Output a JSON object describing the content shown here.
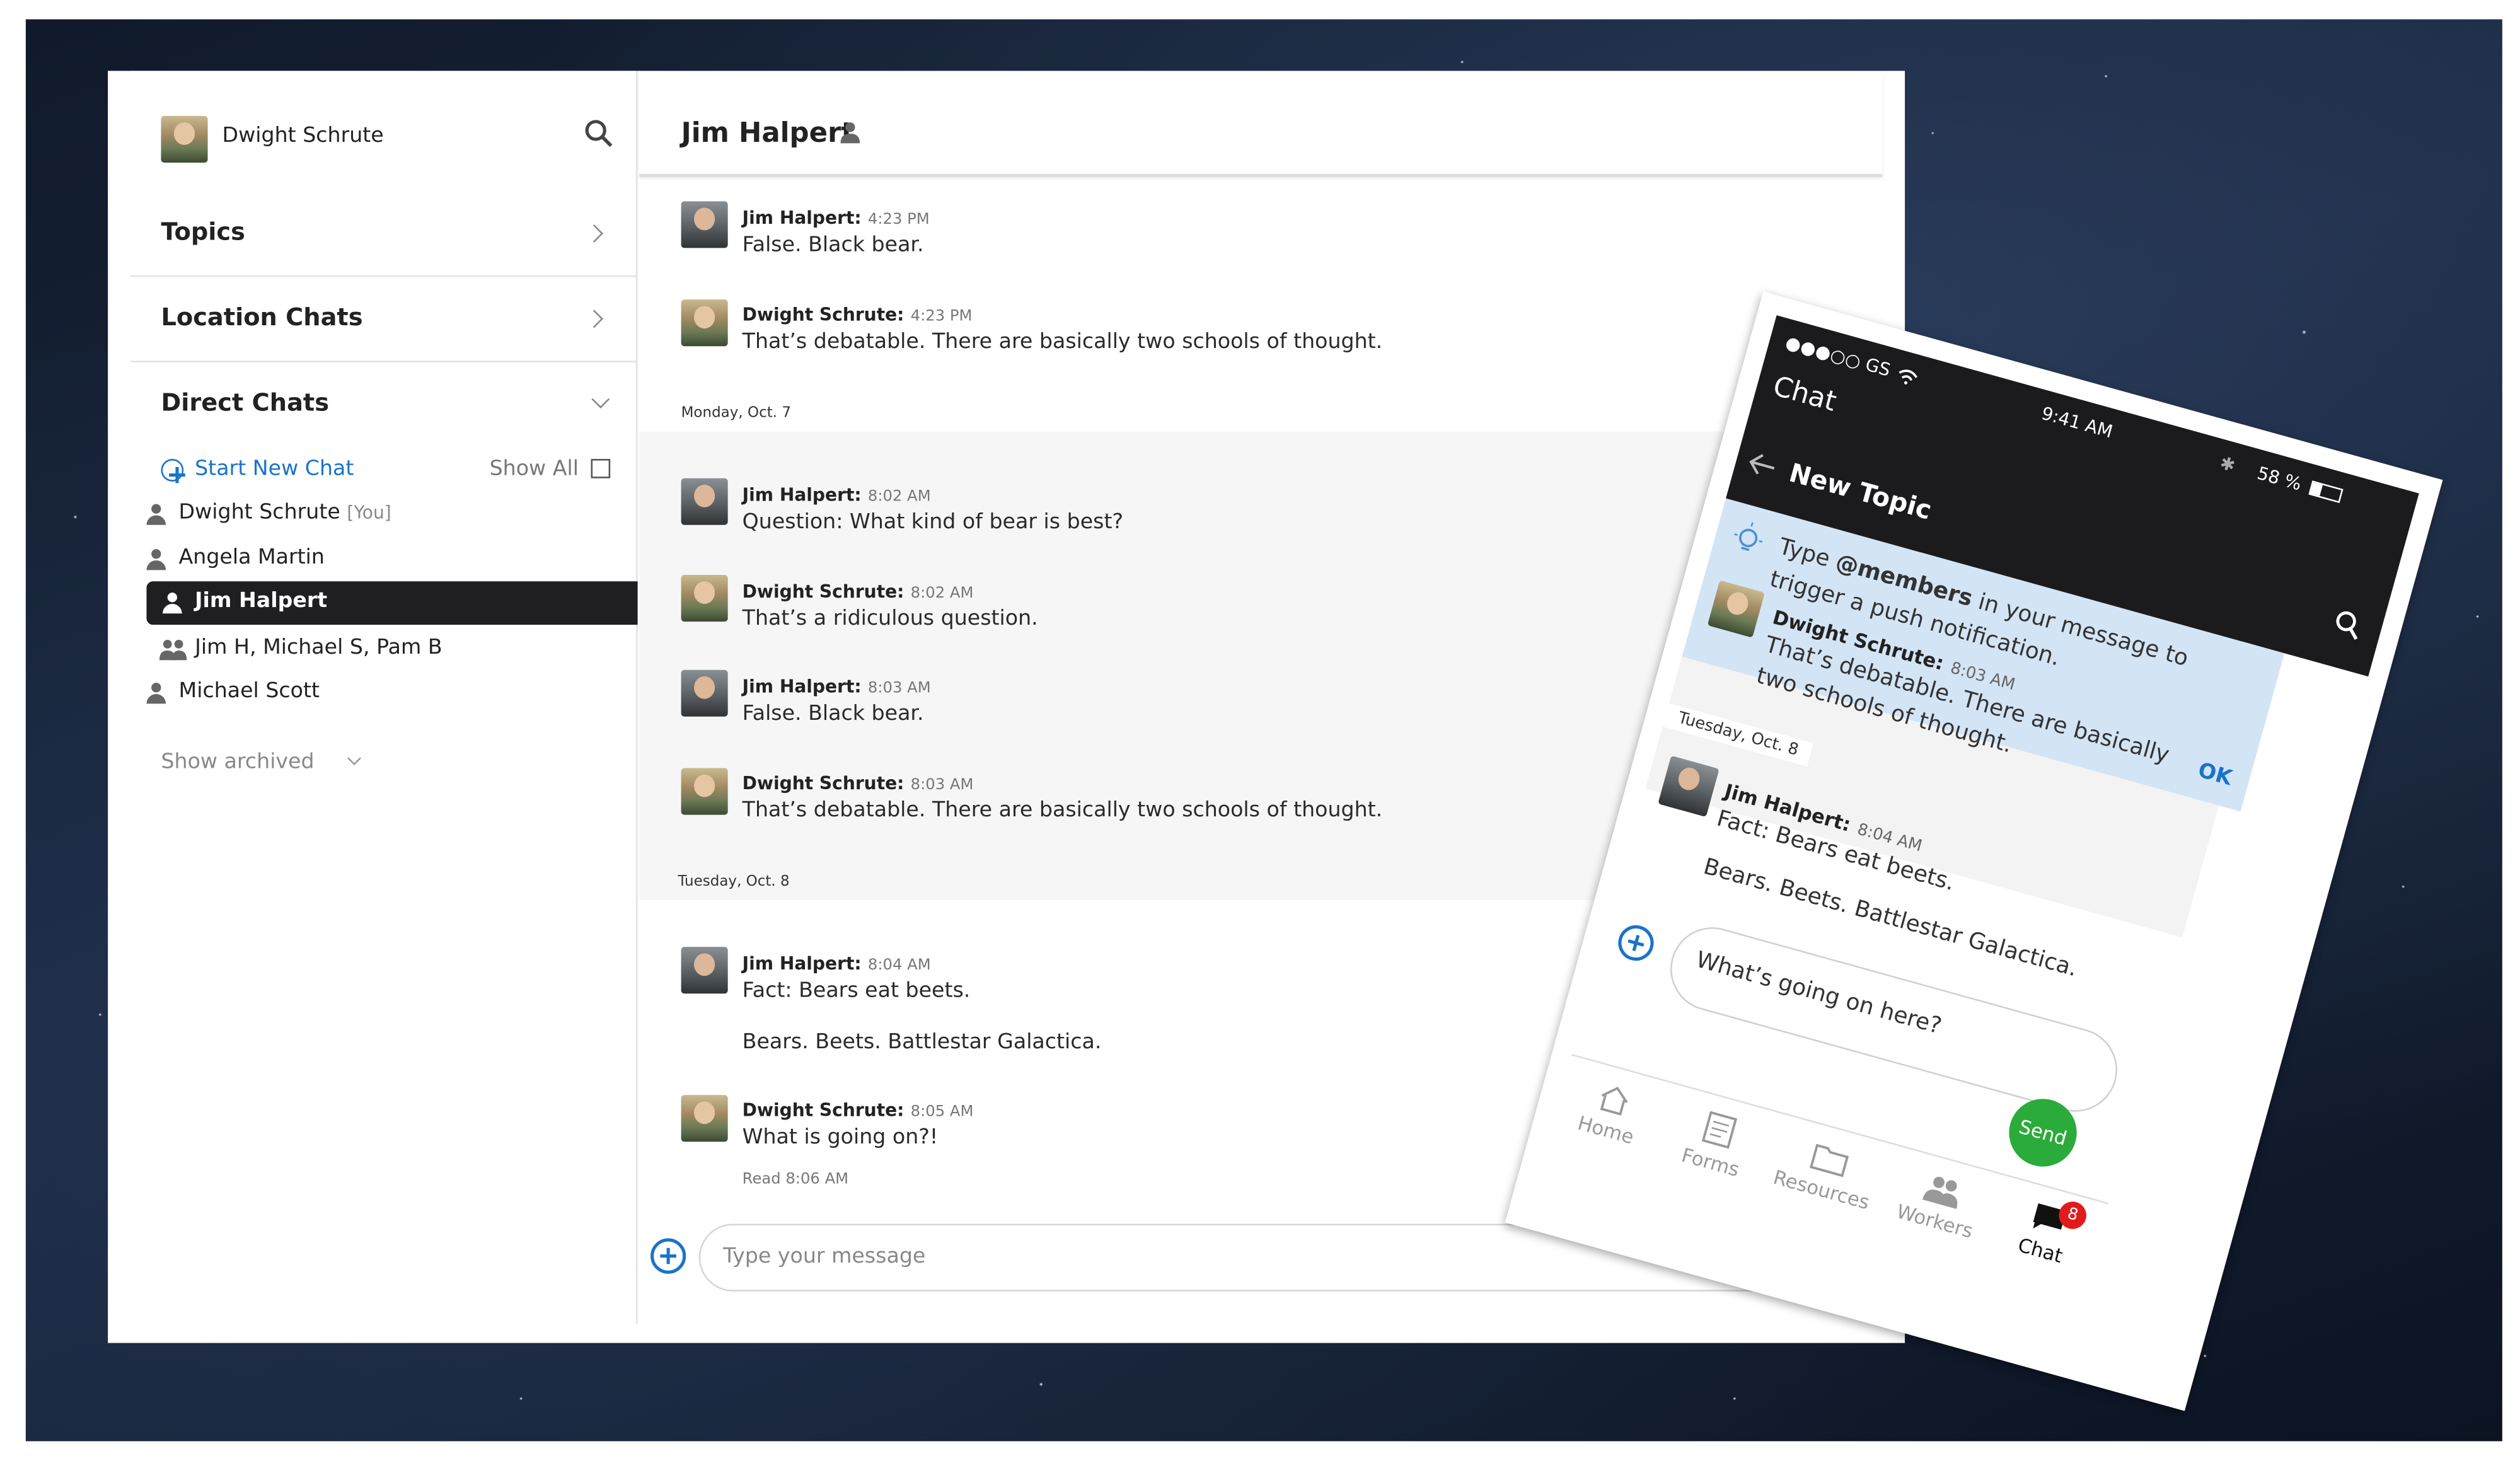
{
  "sidebar": {
    "user_name": "Dwight Schrute",
    "topics_label": "Topics",
    "location_chats_label": "Location Chats",
    "direct_chats_label": "Direct Chats",
    "start_new_chat": "Start New Chat",
    "show_all": "Show All",
    "chats": [
      {
        "name": "Dwight Schrute",
        "suffix": "[You]"
      },
      {
        "name": "Angela Martin"
      },
      {
        "name": "Jim Halpert"
      },
      {
        "name": "Jim H, Michael S, Pam B"
      },
      {
        "name": "Michael Scott"
      }
    ],
    "show_archived": "Show archived"
  },
  "chat": {
    "title": "Jim Halpert",
    "input_placeholder": "Type your message",
    "read_receipt": "Read 8:06 AM",
    "dates": [
      "Monday, Oct. 7",
      "Tuesday, Oct. 8"
    ],
    "messages": [
      {
        "author": "Jim Halpert:",
        "time": "4:23 PM",
        "text": "False. Black bear."
      },
      {
        "author": "Dwight Schrute:",
        "time": "4:23 PM",
        "text": "That’s debatable. There are basically two schools of thought."
      },
      {
        "author": "Jim Halpert:",
        "time": "8:02 AM",
        "text": "Question: What kind of bear is best?"
      },
      {
        "author": "Dwight Schrute:",
        "time": "8:02 AM",
        "text": "That’s a ridiculous question."
      },
      {
        "author": "Jim Halpert:",
        "time": "8:03 AM",
        "text": "False. Black bear."
      },
      {
        "author": "Dwight Schrute:",
        "time": "8:03 AM",
        "text": "That’s debatable. There are basically two schools of thought."
      },
      {
        "author": "Jim Halpert:",
        "time": "8:04 AM",
        "text": "Fact: Bears eat beets.",
        "text2": "Bears. Beets. Battlestar Galactica."
      },
      {
        "author": "Dwight Schrute:",
        "time": "8:05 AM",
        "text": "What is going on?!"
      }
    ]
  },
  "phone": {
    "carrier": "●●●○○ GS",
    "clock": "9:41 AM",
    "battery": "58 %",
    "app_title": "Chat",
    "screen_title": "New Topic",
    "tip_pre": "Type ",
    "tip_bold": "@members",
    "tip_post": " in your message to",
    "tip_line2": "trigger a push notification.",
    "tip_ok": "OK",
    "msg1_author": "Dwight Schrute:",
    "msg1_time": "8:03 AM",
    "msg1_line1": "That’s debatable. There are basically",
    "msg1_line2": "two schools of thought.",
    "date": "Tuesday, Oct. 8",
    "msg2_author": "Jim Halpert:",
    "msg2_time": "8:04 AM",
    "msg2_line1": "Fact: Bears eat beets.",
    "msg2_line2": "Bears. Beets. Battlestar Galactica.",
    "input_value": "What’s going on here?",
    "send": "Send",
    "tabs": [
      {
        "label": "Home"
      },
      {
        "label": "Forms"
      },
      {
        "label": "Resources"
      },
      {
        "label": "Workers"
      },
      {
        "label": "Chat",
        "badge": "8"
      }
    ]
  }
}
